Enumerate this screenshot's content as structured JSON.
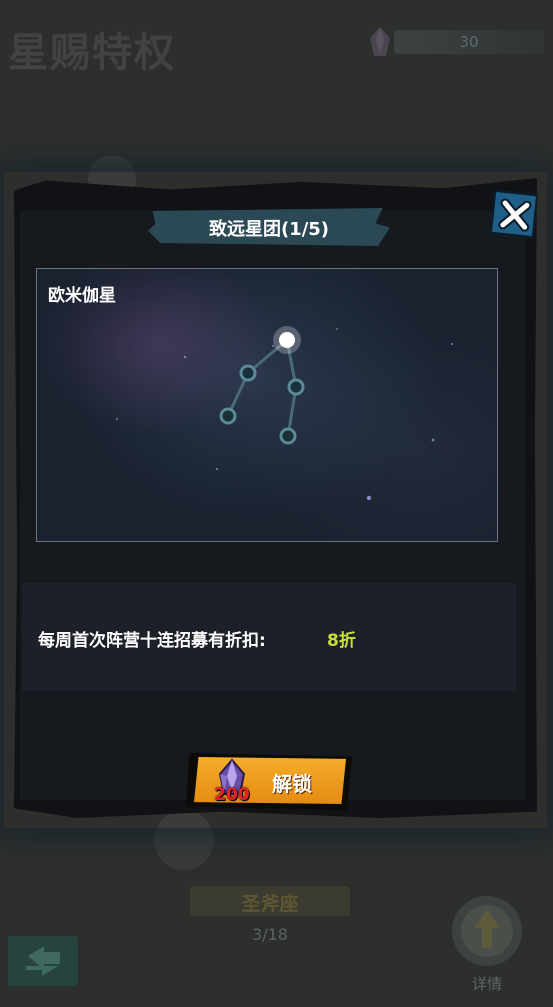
{
  "background": {
    "page_title": "星赐特权",
    "currency": {
      "icon": "crystal-gem-icon",
      "value": "30"
    },
    "constellation_name": "圣斧座",
    "progress": "3/18",
    "detail_label": "详情"
  },
  "modal": {
    "title": "致远星团(1/5)",
    "star_name": "欧米伽星",
    "bonus": {
      "label": "每周首次阵营十连招募有折扣:",
      "value": "8折",
      "value_color": "#c8e03a"
    },
    "unlock_button": {
      "cost": "200",
      "label": "解锁",
      "accent": "#f6ad2b"
    },
    "close_icon": "close-icon"
  }
}
